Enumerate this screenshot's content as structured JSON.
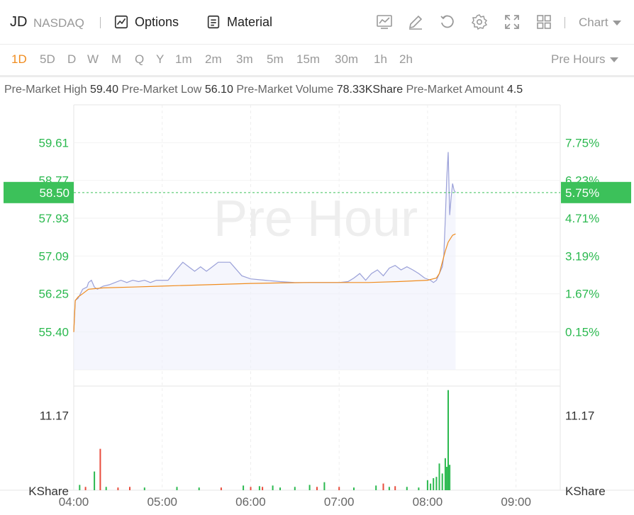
{
  "header": {
    "ticker": "JD",
    "exchange": "NASDAQ",
    "options_label": "Options",
    "material_label": "Material",
    "chart_label": "Chart",
    "icons": [
      "trend-chart-icon",
      "draw-pen-icon",
      "reset-icon",
      "settings-icon",
      "fullscreen-icon",
      "layout-grid-icon"
    ]
  },
  "periods": [
    "1D",
    "5D",
    "D",
    "W",
    "M",
    "Q",
    "Y",
    "1m",
    "2m",
    "3m",
    "5m",
    "15m",
    "30m",
    "1h",
    "2h"
  ],
  "active_period": "1D",
  "session_label": "Pre Hours",
  "stats": [
    {
      "label": "Pre-Market High",
      "value": "59.40"
    },
    {
      "label": "Pre-Market Low",
      "value": "56.10"
    },
    {
      "label": "Pre-Market Volume",
      "value": "78.33KShare"
    },
    {
      "label": "Pre-Market Amount",
      "value": "4.5"
    }
  ],
  "colors": {
    "accent": "#f08c1e",
    "up": "#2bb94f",
    "down": "#e84c3d",
    "price_line": "#9aa0d8",
    "avg_line": "#f08c1e",
    "current_tag": "#3cc15a"
  },
  "chart_data": {
    "type": "line",
    "watermark": "Pre Hour",
    "x_ticks": [
      "04:00",
      "05:00",
      "06:00",
      "07:00",
      "08:00",
      "09:00"
    ],
    "y_ticks": [
      "59.61",
      "58.77",
      "57.93",
      "57.09",
      "56.25",
      "55.40"
    ],
    "y_ticks_pct": [
      "7.75%",
      "6.23%",
      "4.71%",
      "3.19%",
      "1.67%",
      "0.15%"
    ],
    "current_price": "58.50",
    "current_pct": "5.75%",
    "volume_tick": "11.17",
    "volume_unit": "KShare",
    "x_range_min": [
      0,
      330
    ],
    "y_range": [
      54.56,
      60.45
    ],
    "price": [
      [
        0,
        55.4
      ],
      [
        1,
        56.1
      ],
      [
        3,
        56.15
      ],
      [
        6,
        56.35
      ],
      [
        9,
        56.4
      ],
      [
        10,
        56.5
      ],
      [
        12,
        56.55
      ],
      [
        14,
        56.4
      ],
      [
        16,
        56.35
      ],
      [
        20,
        56.42
      ],
      [
        24,
        56.45
      ],
      [
        28,
        56.5
      ],
      [
        32,
        56.55
      ],
      [
        36,
        56.5
      ],
      [
        40,
        56.55
      ],
      [
        44,
        56.52
      ],
      [
        48,
        56.55
      ],
      [
        52,
        56.5
      ],
      [
        56,
        56.55
      ],
      [
        60,
        56.55
      ],
      [
        64,
        56.55
      ],
      [
        70,
        56.8
      ],
      [
        74,
        56.95
      ],
      [
        78,
        56.85
      ],
      [
        82,
        56.75
      ],
      [
        86,
        56.85
      ],
      [
        90,
        56.75
      ],
      [
        94,
        56.85
      ],
      [
        98,
        56.95
      ],
      [
        102,
        56.95
      ],
      [
        106,
        56.95
      ],
      [
        110,
        56.8
      ],
      [
        114,
        56.65
      ],
      [
        120,
        56.58
      ],
      [
        130,
        56.55
      ],
      [
        140,
        56.52
      ],
      [
        150,
        56.5
      ],
      [
        160,
        56.5
      ],
      [
        170,
        56.5
      ],
      [
        180,
        56.5
      ],
      [
        186,
        56.52
      ],
      [
        190,
        56.6
      ],
      [
        194,
        56.7
      ],
      [
        198,
        56.55
      ],
      [
        202,
        56.7
      ],
      [
        206,
        56.78
      ],
      [
        210,
        56.65
      ],
      [
        214,
        56.82
      ],
      [
        218,
        56.88
      ],
      [
        222,
        56.78
      ],
      [
        226,
        56.85
      ],
      [
        230,
        56.78
      ],
      [
        234,
        56.7
      ],
      [
        238,
        56.6
      ],
      [
        242,
        56.55
      ],
      [
        244,
        56.5
      ],
      [
        246,
        56.55
      ],
      [
        248,
        56.7
      ],
      [
        250,
        56.85
      ],
      [
        251,
        57.1
      ],
      [
        252,
        57.9
      ],
      [
        253,
        58.8
      ],
      [
        254,
        59.4
      ],
      [
        255,
        58.0
      ],
      [
        256,
        58.4
      ],
      [
        257,
        58.7
      ],
      [
        258,
        58.55
      ],
      [
        259,
        58.5
      ]
    ],
    "average": [
      [
        0,
        55.4
      ],
      [
        1,
        56.1
      ],
      [
        3,
        56.18
      ],
      [
        6,
        56.25
      ],
      [
        10,
        56.35
      ],
      [
        20,
        56.38
      ],
      [
        40,
        56.4
      ],
      [
        60,
        56.42
      ],
      [
        80,
        56.44
      ],
      [
        100,
        56.46
      ],
      [
        120,
        56.48
      ],
      [
        140,
        56.49
      ],
      [
        160,
        56.5
      ],
      [
        180,
        56.5
      ],
      [
        200,
        56.5
      ],
      [
        220,
        56.52
      ],
      [
        240,
        56.55
      ],
      [
        246,
        56.6
      ],
      [
        248,
        56.7
      ],
      [
        250,
        56.95
      ],
      [
        252,
        57.2
      ],
      [
        254,
        57.4
      ],
      [
        257,
        57.55
      ],
      [
        259,
        57.58
      ]
    ],
    "volume": [
      {
        "t": 4,
        "v": 0.8,
        "d": "up"
      },
      {
        "t": 8,
        "v": 0.5,
        "d": "down"
      },
      {
        "t": 14,
        "v": 2.8,
        "d": "up"
      },
      {
        "t": 18,
        "v": 6.2,
        "d": "down"
      },
      {
        "t": 22,
        "v": 0.5,
        "d": "up"
      },
      {
        "t": 30,
        "v": 0.4,
        "d": "down"
      },
      {
        "t": 38,
        "v": 0.5,
        "d": "down"
      },
      {
        "t": 48,
        "v": 0.4,
        "d": "up"
      },
      {
        "t": 70,
        "v": 0.5,
        "d": "up"
      },
      {
        "t": 85,
        "v": 0.4,
        "d": "up"
      },
      {
        "t": 100,
        "v": 0.4,
        "d": "down"
      },
      {
        "t": 115,
        "v": 0.7,
        "d": "up"
      },
      {
        "t": 120,
        "v": 0.5,
        "d": "down"
      },
      {
        "t": 126,
        "v": 0.6,
        "d": "up"
      },
      {
        "t": 128,
        "v": 0.5,
        "d": "down"
      },
      {
        "t": 135,
        "v": 0.7,
        "d": "up"
      },
      {
        "t": 140,
        "v": 0.4,
        "d": "up"
      },
      {
        "t": 150,
        "v": 0.5,
        "d": "up"
      },
      {
        "t": 160,
        "v": 0.8,
        "d": "up"
      },
      {
        "t": 165,
        "v": 0.5,
        "d": "down"
      },
      {
        "t": 170,
        "v": 1.2,
        "d": "up"
      },
      {
        "t": 180,
        "v": 0.5,
        "d": "down"
      },
      {
        "t": 190,
        "v": 0.4,
        "d": "up"
      },
      {
        "t": 205,
        "v": 0.7,
        "d": "up"
      },
      {
        "t": 210,
        "v": 1.0,
        "d": "down"
      },
      {
        "t": 214,
        "v": 0.5,
        "d": "up"
      },
      {
        "t": 218,
        "v": 0.6,
        "d": "down"
      },
      {
        "t": 226,
        "v": 0.5,
        "d": "up"
      },
      {
        "t": 234,
        "v": 0.4,
        "d": "up"
      },
      {
        "t": 240,
        "v": 1.5,
        "d": "up"
      },
      {
        "t": 242,
        "v": 1.0,
        "d": "up"
      },
      {
        "t": 244,
        "v": 1.8,
        "d": "up"
      },
      {
        "t": 246,
        "v": 2.0,
        "d": "up"
      },
      {
        "t": 248,
        "v": 4.0,
        "d": "up"
      },
      {
        "t": 250,
        "v": 2.5,
        "d": "up"
      },
      {
        "t": 252,
        "v": 4.8,
        "d": "up"
      },
      {
        "t": 253,
        "v": 3.5,
        "d": "up"
      },
      {
        "t": 254,
        "v": 15.0,
        "d": "up"
      },
      {
        "t": 255,
        "v": 3.8,
        "d": "up"
      }
    ],
    "volume_max": 15.6
  }
}
